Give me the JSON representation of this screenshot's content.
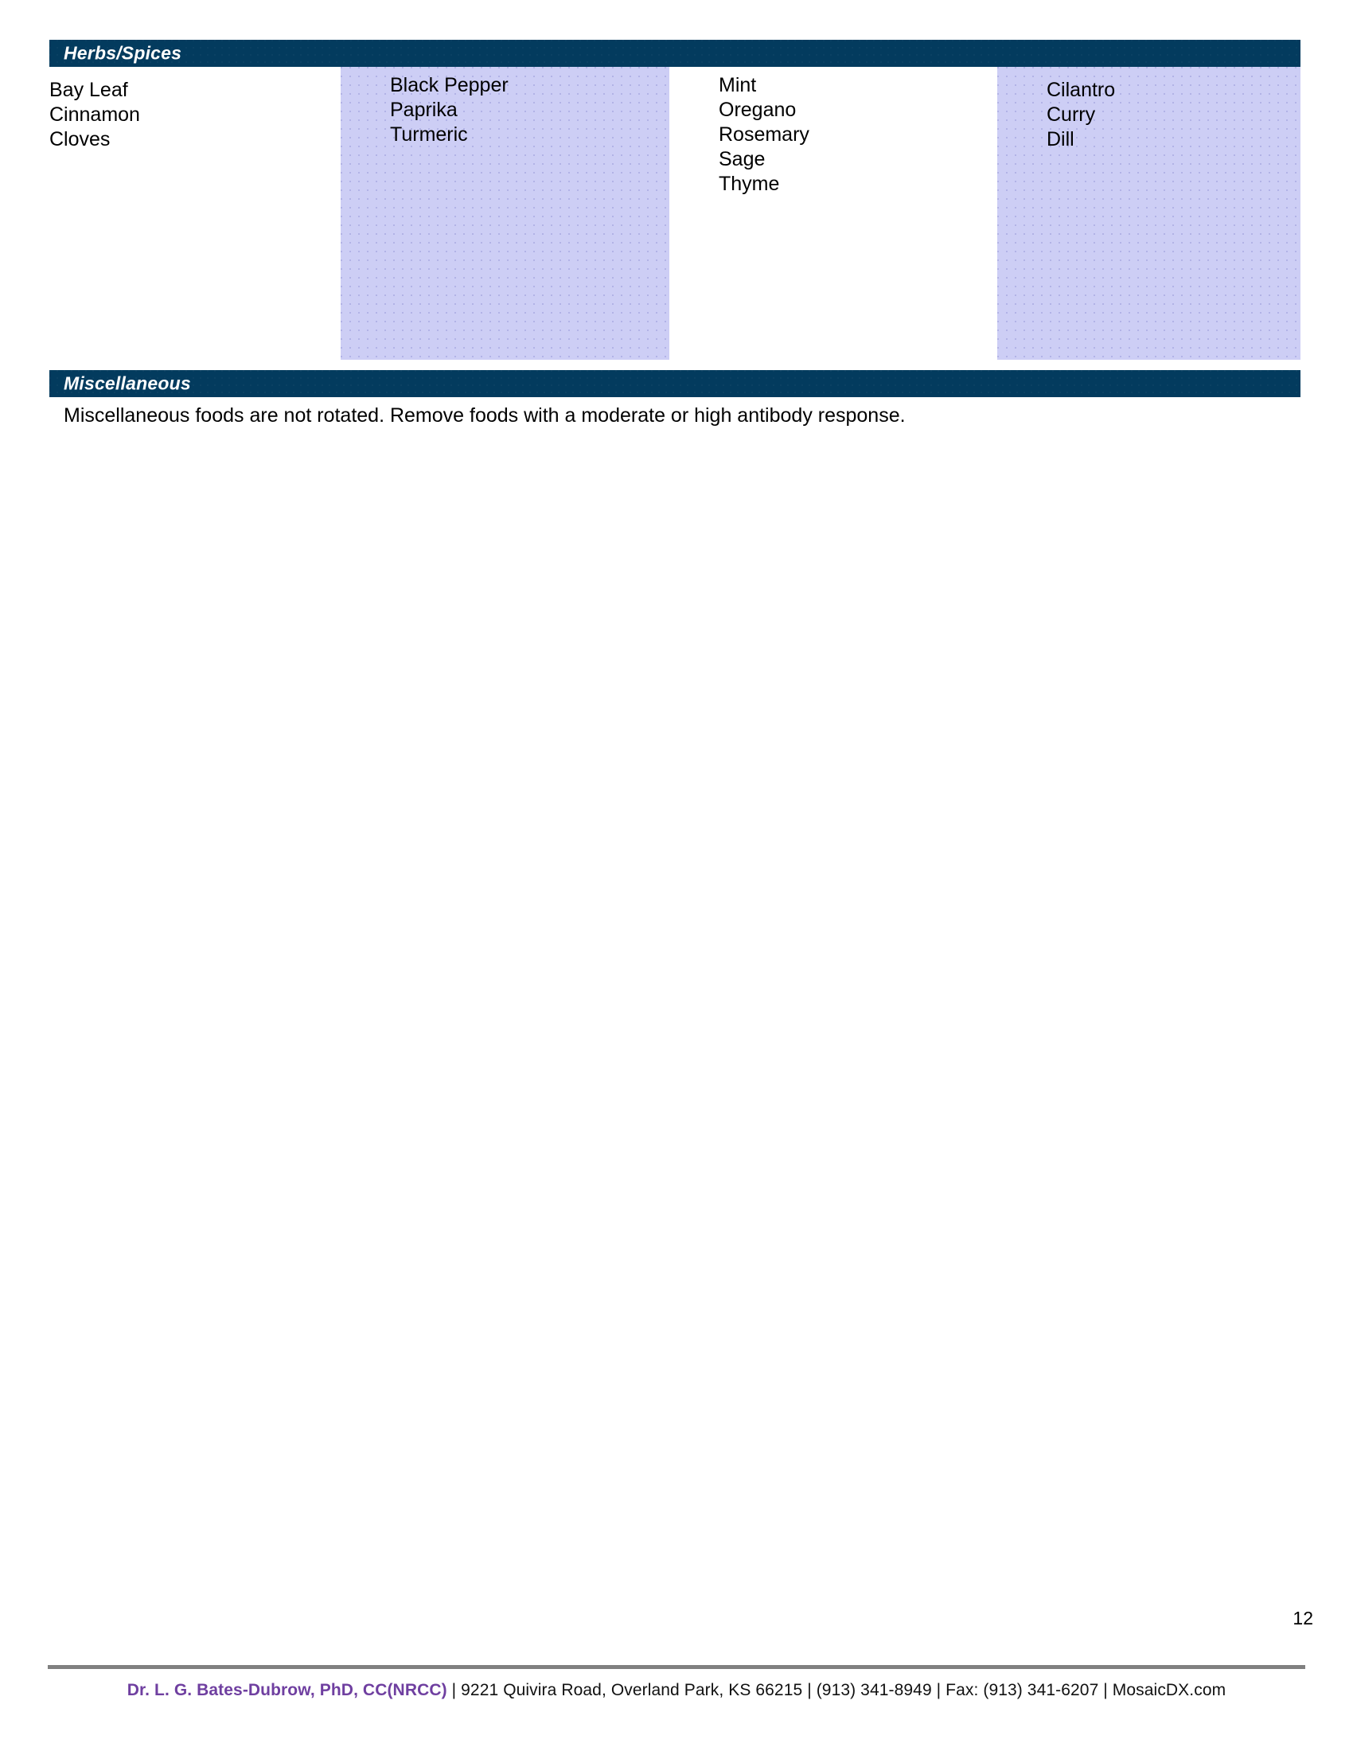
{
  "document": {
    "page_number": "12"
  },
  "colors": {
    "header_bar": "#033b5e",
    "shaded_column": "#cdcef5",
    "doctor_name": "#6f3fa0",
    "footer_rule": "#808080"
  },
  "sections": {
    "herbs_spices": {
      "title": "Herbs/Spices",
      "columns": [
        {
          "shaded": false,
          "items": [
            "Bay Leaf",
            "Cinnamon",
            "Cloves"
          ]
        },
        {
          "shaded": true,
          "items": [
            "Black Pepper",
            "Paprika",
            "Turmeric"
          ]
        },
        {
          "shaded": false,
          "items": [
            "Mint",
            "Oregano",
            "Rosemary",
            "Sage",
            "Thyme"
          ]
        },
        {
          "shaded": true,
          "items": [
            "Cilantro",
            "Curry",
            "Dill"
          ]
        }
      ]
    },
    "miscellaneous": {
      "title": "Miscellaneous",
      "note": "Miscellaneous foods are not rotated. Remove foods with a moderate or high antibody response."
    }
  },
  "footer": {
    "doctor": "Dr. L. G. Bates-Dubrow, PhD, CC(NRCC)",
    "separator_1": " | ",
    "address": "9221 Quivira Road, Overland Park, KS 66215",
    "separator_2": "  |  ",
    "phone": "(913) 341-8949",
    "separator_3": "  |  ",
    "fax": "Fax: (913) 341-6207",
    "separator_4": " | ",
    "website": "MosaicDX.com"
  }
}
